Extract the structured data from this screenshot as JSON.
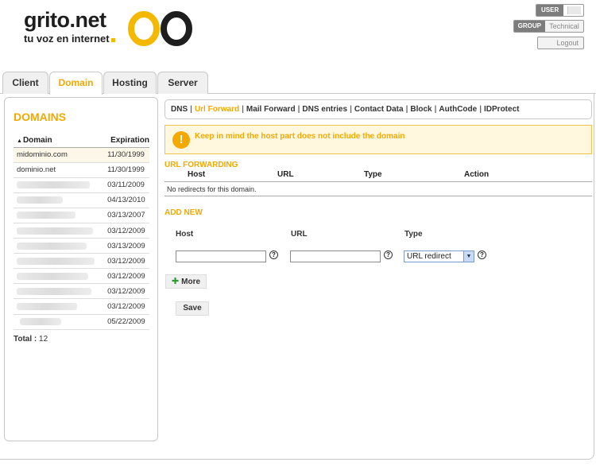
{
  "logo": {
    "name": "grito.net",
    "tagline": "tu voz en internet"
  },
  "user_controls": {
    "user_label": "USER",
    "group_label": "GROUP",
    "group_value": "Technical",
    "logout_label": "Logout"
  },
  "tabs": [
    {
      "label": "Client"
    },
    {
      "label": "Domain"
    },
    {
      "label": "Hosting"
    },
    {
      "label": "Server"
    }
  ],
  "domains": {
    "title": "DOMAINS",
    "col_domain": "Domain",
    "col_expiration": "Expiration",
    "rows": [
      {
        "name": "midominio.com",
        "exp": "11/30/1999"
      },
      {
        "name": "dominio.net",
        "exp": "11/30/1999"
      },
      {
        "name": "",
        "exp": "03/11/2009"
      },
      {
        "name": "",
        "exp": "04/13/2010"
      },
      {
        "name": "",
        "exp": "03/13/2007"
      },
      {
        "name": "",
        "exp": "03/12/2009"
      },
      {
        "name": "",
        "exp": "03/13/2009"
      },
      {
        "name": "",
        "exp": "03/12/2009"
      },
      {
        "name": "",
        "exp": "03/12/2009"
      },
      {
        "name": "",
        "exp": "03/12/2009"
      },
      {
        "name": "",
        "exp": "03/12/2009"
      },
      {
        "name": "",
        "exp": "05/22/2009"
      }
    ],
    "total_label": "Total",
    "total_value": "12"
  },
  "subnav": {
    "items": [
      "DNS",
      "Url Forward",
      "Mail Forward",
      "DNS entries",
      "Contact Data",
      "Block",
      "AuthCode",
      "IDProtect"
    ],
    "active": "Url Forward"
  },
  "alert": {
    "text": "Keep in mind the host part does not include the domain"
  },
  "url_forwarding": {
    "title": "URL FORWARDING",
    "columns": [
      "Host",
      "URL",
      "Type",
      "Action"
    ],
    "empty_text": "No redirects for this domain."
  },
  "add_new": {
    "title": "ADD NEW",
    "host_label": "Host",
    "url_label": "URL",
    "type_label": "Type",
    "host_value": "",
    "url_value": "",
    "type_selected": "URL redirect",
    "help_glyph": "?",
    "more_label": "More",
    "save_label": "Save"
  },
  "colors": {
    "accent": "#f2a900",
    "alert_bg": "#fff8df",
    "alert_border": "#f2c14a"
  }
}
